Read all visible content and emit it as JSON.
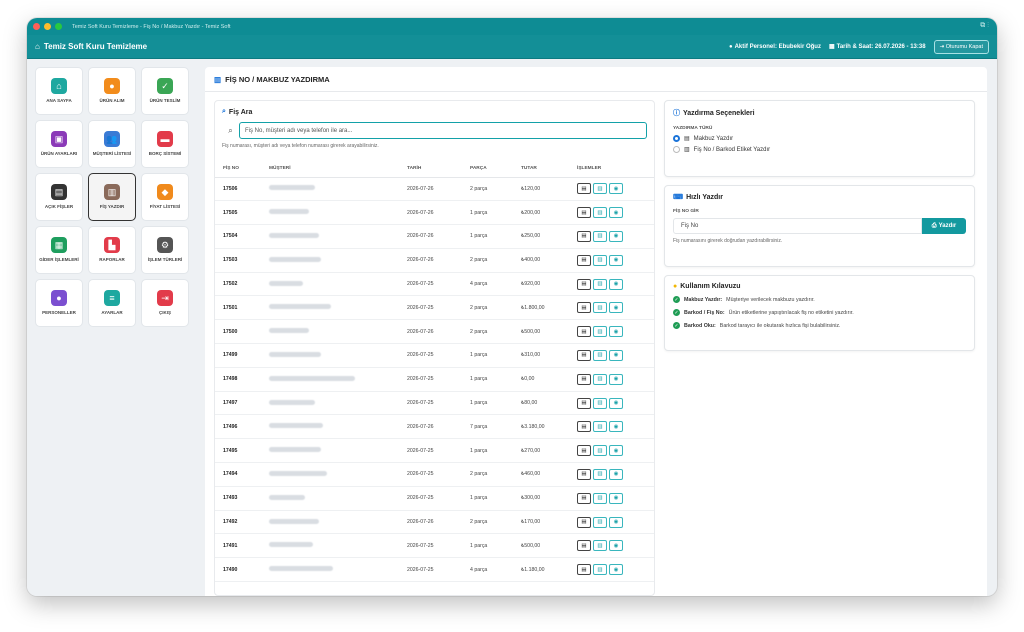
{
  "window": {
    "title": "Temiz Soft Kuru Temizleme - Fiş No / Makbuz Yazdır - Temiz Soft"
  },
  "appbar": {
    "brand": "Temiz Soft Kuru Temizleme",
    "personnel": "Aktif Personel: Ebubekir Oğuz",
    "datetime": "Tarih & Saat: 26.07.2026 - 13:38",
    "logout": "Oturumu Kapat"
  },
  "sidebar": {
    "tiles": [
      {
        "label": "ANA SAYFA",
        "icon": "home-icon",
        "color": "#1ea8a0",
        "glyph": "⌂"
      },
      {
        "label": "ÜRÜN ALIM",
        "icon": "receive-icon",
        "color": "#f28c1c",
        "glyph": "●"
      },
      {
        "label": "ÜRÜN TESLİM",
        "icon": "deliver-icon",
        "color": "#3aa655",
        "glyph": "✓"
      },
      {
        "label": "ÜRÜN AYARLARI",
        "icon": "box-icon",
        "color": "#8b3ab8",
        "glyph": "▣"
      },
      {
        "label": "MÜŞTERİ LİSTESİ",
        "icon": "users-icon",
        "color": "#3a7bd5",
        "glyph": "👥"
      },
      {
        "label": "BORÇ SİSTEMİ",
        "icon": "wallet-icon",
        "color": "#e23b4a",
        "glyph": "▬"
      },
      {
        "label": "AÇIK FİŞLER",
        "icon": "document-icon",
        "color": "#333333",
        "glyph": "▤"
      },
      {
        "label": "FİŞ YAZDIR",
        "icon": "barcode-icon",
        "color": "#8a6a5a",
        "glyph": "▥"
      },
      {
        "label": "FİYAT LİSTESİ",
        "icon": "tag-icon",
        "color": "#f08a1c",
        "glyph": "◆"
      },
      {
        "label": "GİDER İŞLEMLERİ",
        "icon": "money-icon",
        "color": "#1e9e5e",
        "glyph": "▦"
      },
      {
        "label": "RAPORLAR",
        "icon": "chart-icon",
        "color": "#e23b4a",
        "glyph": "▙"
      },
      {
        "label": "İŞLEM TÜRLERİ",
        "icon": "cogs-icon",
        "color": "#555555",
        "glyph": "⚙"
      },
      {
        "label": "PERSONELLER",
        "icon": "person-icon",
        "color": "#7b4fd0",
        "glyph": "●"
      },
      {
        "label": "AYARLAR",
        "icon": "sliders-icon",
        "color": "#1ea8a0",
        "glyph": "≡"
      },
      {
        "label": "ÇIKIŞ",
        "icon": "exit-icon",
        "color": "#e23b4a",
        "glyph": "⇥"
      }
    ]
  },
  "page": {
    "title": "FİŞ NO / MAKBUZ YAZDIRMA"
  },
  "search": {
    "title": "Fiş Ara",
    "placeholder": "Fiş No, müşteri adı veya telefon ile ara...",
    "hint": "Fiş numarası, müşteri adı veya telefon numarası girerek arayabilirsiniz."
  },
  "table": {
    "headers": [
      "FİŞ NO",
      "MÜŞTERİ",
      "TARİH",
      "PARÇA",
      "TUTAR",
      "İŞLEMLER"
    ],
    "rows": [
      {
        "fis": "17506",
        "date": "2026-07-26",
        "parca": "2 parça",
        "tutar": "₺120,00"
      },
      {
        "fis": "17505",
        "date": "2026-07-26",
        "parca": "1 parça",
        "tutar": "₺200,00"
      },
      {
        "fis": "17504",
        "date": "2026-07-26",
        "parca": "1 parça",
        "tutar": "₺250,00"
      },
      {
        "fis": "17503",
        "date": "2026-07-26",
        "parca": "2 parça",
        "tutar": "₺400,00"
      },
      {
        "fis": "17502",
        "date": "2026-07-25",
        "parca": "4 parça",
        "tutar": "₺920,00"
      },
      {
        "fis": "17501",
        "date": "2026-07-25",
        "parca": "2 parça",
        "tutar": "₺1.800,00"
      },
      {
        "fis": "17500",
        "date": "2026-07-26",
        "parca": "2 parça",
        "tutar": "₺500,00"
      },
      {
        "fis": "17499",
        "date": "2026-07-25",
        "parca": "1 parça",
        "tutar": "₺310,00"
      },
      {
        "fis": "17498",
        "date": "2026-07-25",
        "parca": "1 parça",
        "tutar": "₺0,00"
      },
      {
        "fis": "17497",
        "date": "2026-07-25",
        "parca": "1 parça",
        "tutar": "₺80,00"
      },
      {
        "fis": "17496",
        "date": "2026-07-26",
        "parca": "7 parça",
        "tutar": "₺3.180,00"
      },
      {
        "fis": "17495",
        "date": "2026-07-25",
        "parca": "1 parça",
        "tutar": "₺270,00"
      },
      {
        "fis": "17494",
        "date": "2026-07-25",
        "parca": "2 parça",
        "tutar": "₺460,00"
      },
      {
        "fis": "17493",
        "date": "2026-07-25",
        "parca": "1 parça",
        "tutar": "₺300,00"
      },
      {
        "fis": "17492",
        "date": "2026-07-26",
        "parca": "2 parça",
        "tutar": "₺170,00"
      },
      {
        "fis": "17491",
        "date": "2026-07-25",
        "parca": "1 parça",
        "tutar": "₺500,00"
      },
      {
        "fis": "17490",
        "date": "2026-07-25",
        "parca": "4 parça",
        "tutar": "₺1.180,00"
      }
    ]
  },
  "print_options": {
    "title": "Yazdırma Seçenekleri",
    "type_label": "YAZDIRMA TÜRÜ",
    "options": [
      "Makbuz Yazdır",
      "Fiş No / Barkod Etiket Yazdır"
    ]
  },
  "quick_print": {
    "title": "Hızlı Yazdır",
    "field_label": "FİŞ NO GİR",
    "placeholder": "Fiş No",
    "button": "Yazdır",
    "hint": "Fiş numarasını girerek doğrudan yazdırabilirsiniz."
  },
  "guide": {
    "title": "Kullanım Kılavuzu",
    "items": [
      {
        "bold": "Makbuz Yazdır:",
        "text": "Müşteriye verilecek makbuzu yazdırır."
      },
      {
        "bold": "Barkod / Fiş No:",
        "text": "Ürün etiketlerine yapıştırılacak fiş no etiketini yazdırır."
      },
      {
        "bold": "Barkod Oku:",
        "text": "Barkod tarayıcı ile okutarak hızlıca fişi bulabilirsiniz."
      }
    ]
  }
}
